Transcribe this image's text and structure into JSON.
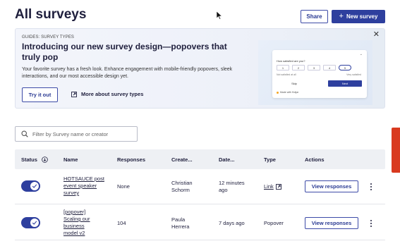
{
  "header": {
    "title": "All surveys",
    "share_label": "Share",
    "new_survey_label": "New survey"
  },
  "banner": {
    "kicker": "GUIDES: SURVEY TYPES",
    "title": "Introducing our new survey design—popovers that truly pop",
    "text": "Your favorite survey has a fresh look. Enhance engagement with mobile-friendly popovers, sleek interactions, and our most accessible design yet.",
    "try_label": "Try it out",
    "more_label": "More about survey types",
    "preview": {
      "question": "How satisfied are you?",
      "options": [
        "1",
        "2",
        "3",
        "4",
        "5"
      ],
      "selected_option": "5",
      "low_label": "Not satisfied at all",
      "high_label": "Very satisfied",
      "skip_label": "Skip",
      "next_label": "Next",
      "made_with": "Made with Hotjar"
    }
  },
  "search": {
    "placeholder": "Filter by Survey name or creator",
    "value": ""
  },
  "table": {
    "columns": [
      "Status",
      "Name",
      "Responses",
      "Create...",
      "Date...",
      "Type",
      "Actions"
    ],
    "rows": [
      {
        "status_on": true,
        "name": "HOTSAUCE post event speaker survey",
        "responses": "None",
        "creator": "Christian Schorm",
        "date": "12 minutes ago",
        "type": "Link",
        "action_label": "View responses"
      },
      {
        "status_on": true,
        "name": "[popover] Scaling our business model v2",
        "responses": "104",
        "creator": "Paula Herrera",
        "date": "7 days ago",
        "type": "Popover",
        "action_label": "View responses"
      }
    ]
  },
  "colors": {
    "primary": "#2e3f9e",
    "text": "#1f1f3d",
    "feedback_tab": "#d93a1f"
  },
  "icons": [
    "search-icon",
    "close-icon",
    "plus-icon",
    "external-link-icon",
    "sort-icon",
    "check-icon",
    "kebab-icon",
    "cursor-icon"
  ]
}
